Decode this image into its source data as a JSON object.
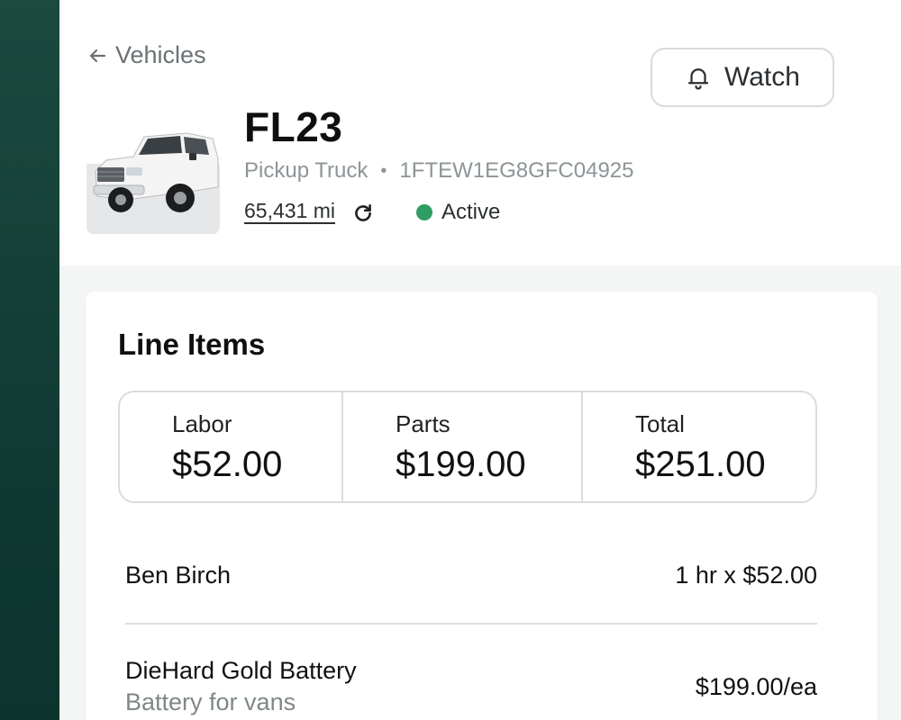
{
  "header": {
    "back_label": "Vehicles",
    "watch_label": "Watch",
    "vehicle_name": "FL23",
    "vehicle_type": "Pickup Truck",
    "vin": "1FTEW1EG8GFC04925",
    "mileage": "65,431 mi",
    "status": "Active",
    "status_color": "#2f9e63"
  },
  "line_items": {
    "title": "Line Items",
    "totals": [
      {
        "label": "Labor",
        "value": "$52.00"
      },
      {
        "label": "Parts",
        "value": "$199.00"
      },
      {
        "label": "Total",
        "value": "$251.00"
      }
    ],
    "rows": [
      {
        "name": "Ben Birch",
        "description": "",
        "amount": "1 hr x $52.00"
      },
      {
        "name": "DieHard Gold Battery",
        "description": "Battery for vans",
        "amount": "$199.00/ea"
      }
    ]
  },
  "colors": {
    "sidebar": "#1c4a3f",
    "accent_status": "#2f9e63"
  }
}
